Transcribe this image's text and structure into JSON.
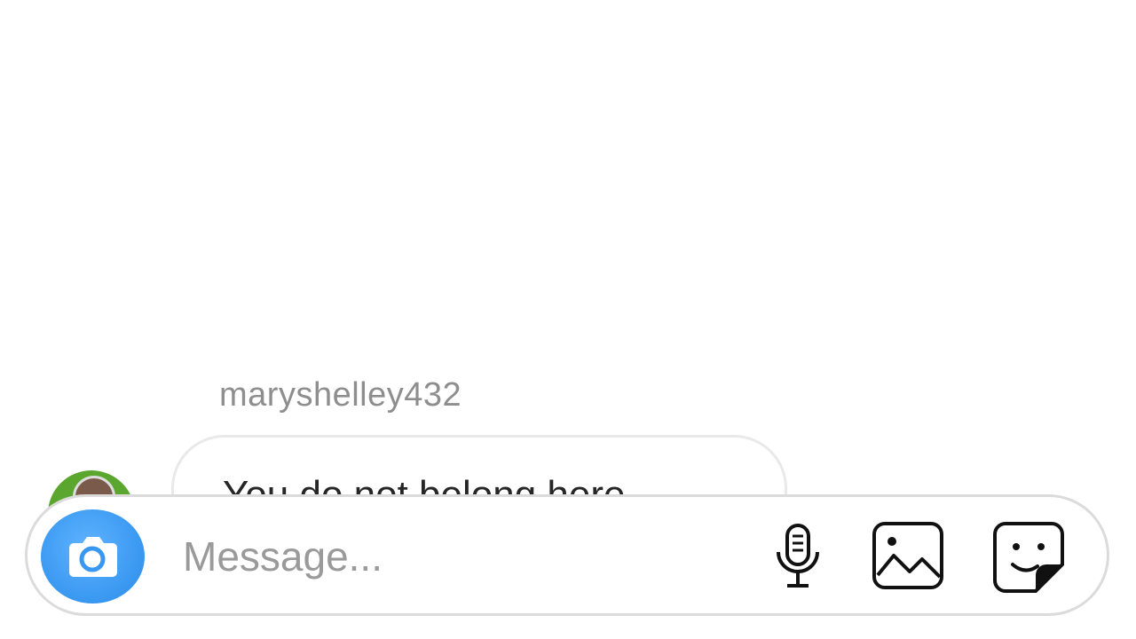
{
  "thread": {
    "sender_username": "maryshelley432",
    "message_text": "You do not belong here"
  },
  "composer": {
    "placeholder": "Message...",
    "icons": {
      "camera": "camera-icon",
      "mic": "microphone-icon",
      "gallery": "gallery-icon",
      "sticker": "sticker-icon"
    },
    "colors": {
      "camera_button": "#3897f0"
    }
  }
}
